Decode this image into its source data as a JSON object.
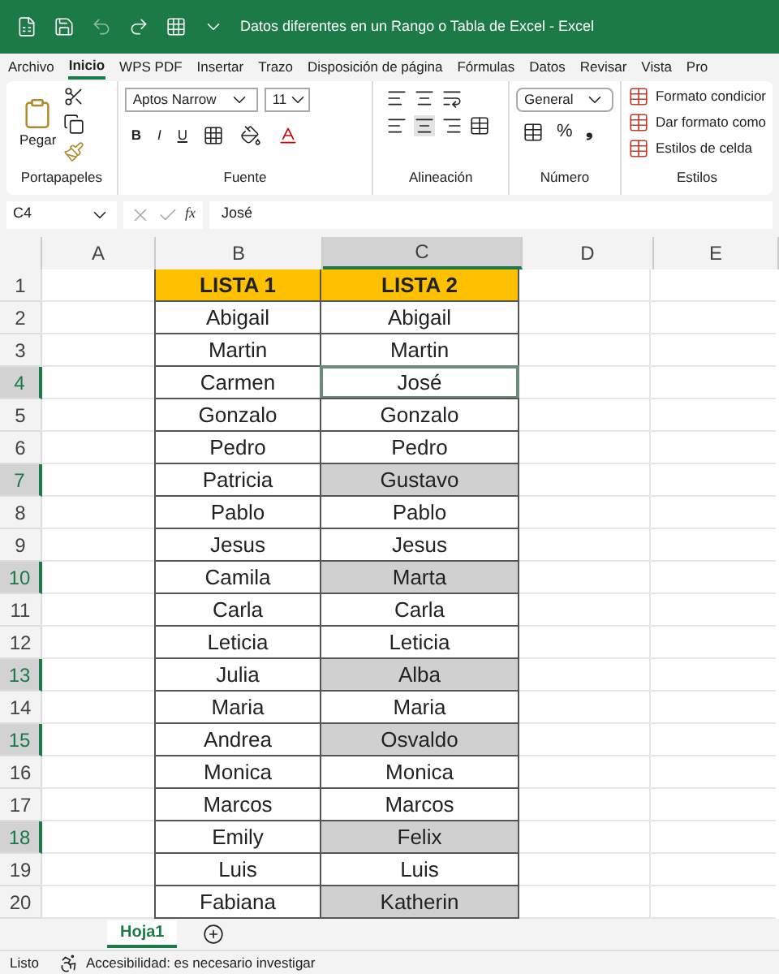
{
  "window": {
    "title": "Datos diferentes en un Rango o Tabla de Excel  -  Excel"
  },
  "menu": [
    {
      "label": "Archivo",
      "selected": false
    },
    {
      "label": "Inicio",
      "selected": true
    },
    {
      "label": "WPS PDF",
      "selected": false
    },
    {
      "label": "Insertar",
      "selected": false
    },
    {
      "label": "Trazo",
      "selected": false
    },
    {
      "label": "Disposición de página",
      "selected": false
    },
    {
      "label": "Fórmulas",
      "selected": false
    },
    {
      "label": "Datos",
      "selected": false
    },
    {
      "label": "Revisar",
      "selected": false
    },
    {
      "label": "Vista",
      "selected": false
    },
    {
      "label": "Pro",
      "selected": false
    }
  ],
  "ribbon": {
    "paste": "Pegar",
    "font_name": "Aptos Narrow",
    "font_size": "11",
    "bold": "B",
    "italic": "I",
    "underline": "U",
    "number_format": "General",
    "percent": "%",
    "comma": "❟",
    "styles": [
      "Formato condicior",
      "Dar formato como",
      "Estilos de celda"
    ],
    "groups": [
      "Portapapeles",
      "Fuente",
      "Alineación",
      "Número",
      "Estilos"
    ]
  },
  "formula_bar": {
    "name_box": "C4",
    "fx": "fx",
    "value": "José"
  },
  "columns": [
    {
      "label": "A",
      "selected": false
    },
    {
      "label": "B",
      "selected": false
    },
    {
      "label": "C",
      "selected": true
    },
    {
      "label": "D",
      "selected": false
    },
    {
      "label": "E",
      "selected": false
    }
  ],
  "rows": [
    {
      "number": "1",
      "b": "LISTA 1",
      "c": "LISTA 2",
      "kind": "header",
      "active": false,
      "selected": false
    },
    {
      "number": "2",
      "b": "Abigail",
      "c": "Abigail",
      "kind": "data",
      "shaded": false,
      "active": false,
      "selected": false
    },
    {
      "number": "3",
      "b": "Martin",
      "c": "Martin",
      "kind": "data",
      "shaded": false,
      "active": false,
      "selected": false
    },
    {
      "number": "4",
      "b": "Carmen",
      "c": "José",
      "kind": "data",
      "shaded": false,
      "active": true,
      "selected": true
    },
    {
      "number": "5",
      "b": "Gonzalo",
      "c": "Gonzalo",
      "kind": "data",
      "shaded": false,
      "active": false,
      "selected": false
    },
    {
      "number": "6",
      "b": "Pedro",
      "c": "Pedro",
      "kind": "data",
      "shaded": false,
      "active": false,
      "selected": false
    },
    {
      "number": "7",
      "b": "Patricia",
      "c": "Gustavo",
      "kind": "data",
      "shaded": true,
      "active": false,
      "selected": true
    },
    {
      "number": "8",
      "b": "Pablo",
      "c": "Pablo",
      "kind": "data",
      "shaded": false,
      "active": false,
      "selected": false
    },
    {
      "number": "9",
      "b": "Jesus",
      "c": "Jesus",
      "kind": "data",
      "shaded": false,
      "active": false,
      "selected": false
    },
    {
      "number": "10",
      "b": "Camila",
      "c": "Marta",
      "kind": "data",
      "shaded": true,
      "active": false,
      "selected": true
    },
    {
      "number": "11",
      "b": "Carla",
      "c": "Carla",
      "kind": "data",
      "shaded": false,
      "active": false,
      "selected": false
    },
    {
      "number": "12",
      "b": "Leticia",
      "c": "Leticia",
      "kind": "data",
      "shaded": false,
      "active": false,
      "selected": false
    },
    {
      "number": "13",
      "b": "Julia",
      "c": "Alba",
      "kind": "data",
      "shaded": true,
      "active": false,
      "selected": true
    },
    {
      "number": "14",
      "b": "Maria",
      "c": "Maria",
      "kind": "data",
      "shaded": false,
      "active": false,
      "selected": false
    },
    {
      "number": "15",
      "b": "Andrea",
      "c": "Osvaldo",
      "kind": "data",
      "shaded": true,
      "active": false,
      "selected": true
    },
    {
      "number": "16",
      "b": "Monica",
      "c": "Monica",
      "kind": "data",
      "shaded": false,
      "active": false,
      "selected": false
    },
    {
      "number": "17",
      "b": "Marcos",
      "c": "Marcos",
      "kind": "data",
      "shaded": false,
      "active": false,
      "selected": false
    },
    {
      "number": "18",
      "b": "Emily",
      "c": "Felix",
      "kind": "data",
      "shaded": true,
      "active": false,
      "selected": true
    },
    {
      "number": "19",
      "b": "Luis",
      "c": "Luis",
      "kind": "data",
      "shaded": false,
      "active": false,
      "selected": false
    },
    {
      "number": "20",
      "b": "Fabiana",
      "c": "Katherin",
      "kind": "data",
      "shaded": true,
      "active": false,
      "selected": false
    }
  ],
  "sheets": [
    {
      "label": "Hoja1",
      "selected": true
    }
  ],
  "status_bar": {
    "ready": "Listo",
    "accessibility": "Accesibilidad: es necesario investigar"
  }
}
